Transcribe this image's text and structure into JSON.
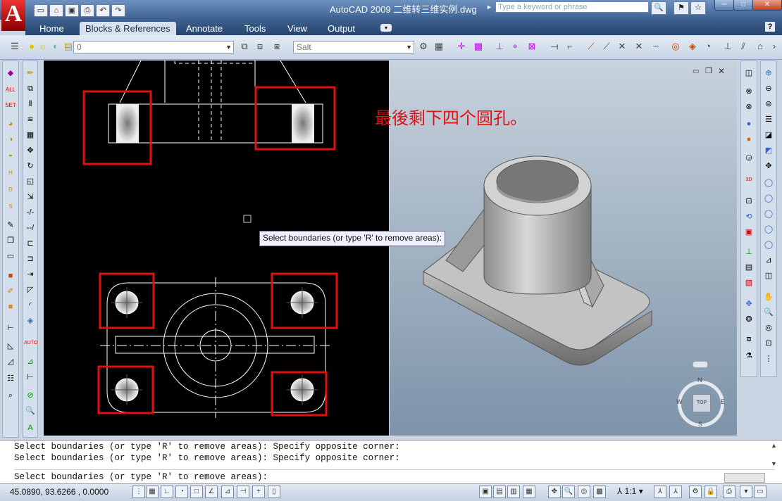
{
  "app": {
    "title": "AutoCAD 2009 二维转三维实例.dwg",
    "search_placeholder": "Type a keyword or phrase",
    "logo_letter": "A"
  },
  "ribbon_tabs": [
    "Home",
    "Blocks & References",
    "Annotate",
    "Tools",
    "View",
    "Output"
  ],
  "active_tab": "Blocks & References",
  "layer_combo": {
    "value": "0"
  },
  "style_combo": {
    "value": "Salt"
  },
  "annotation_text": "最後剩下四个圆孔。",
  "tooltip_text": "Select boundaries (or type 'R' to remove areas):",
  "viewcube": {
    "face": "TOP",
    "n": "N",
    "s": "S",
    "e": "E",
    "w": "W"
  },
  "command_history": [
    "Select boundaries (or type 'R' to remove areas): Specify opposite corner:",
    "Select boundaries (or type 'R' to remove areas): Specify opposite corner:"
  ],
  "command_prompt": "Select boundaries (or type 'R' to remove areas):",
  "status": {
    "coordinates": "45.0890, 93.6266 , 0.0000",
    "annotation_scale": "1:1"
  },
  "colors": {
    "highlight_red": "#e01010",
    "viewport_bg": "#000000"
  }
}
